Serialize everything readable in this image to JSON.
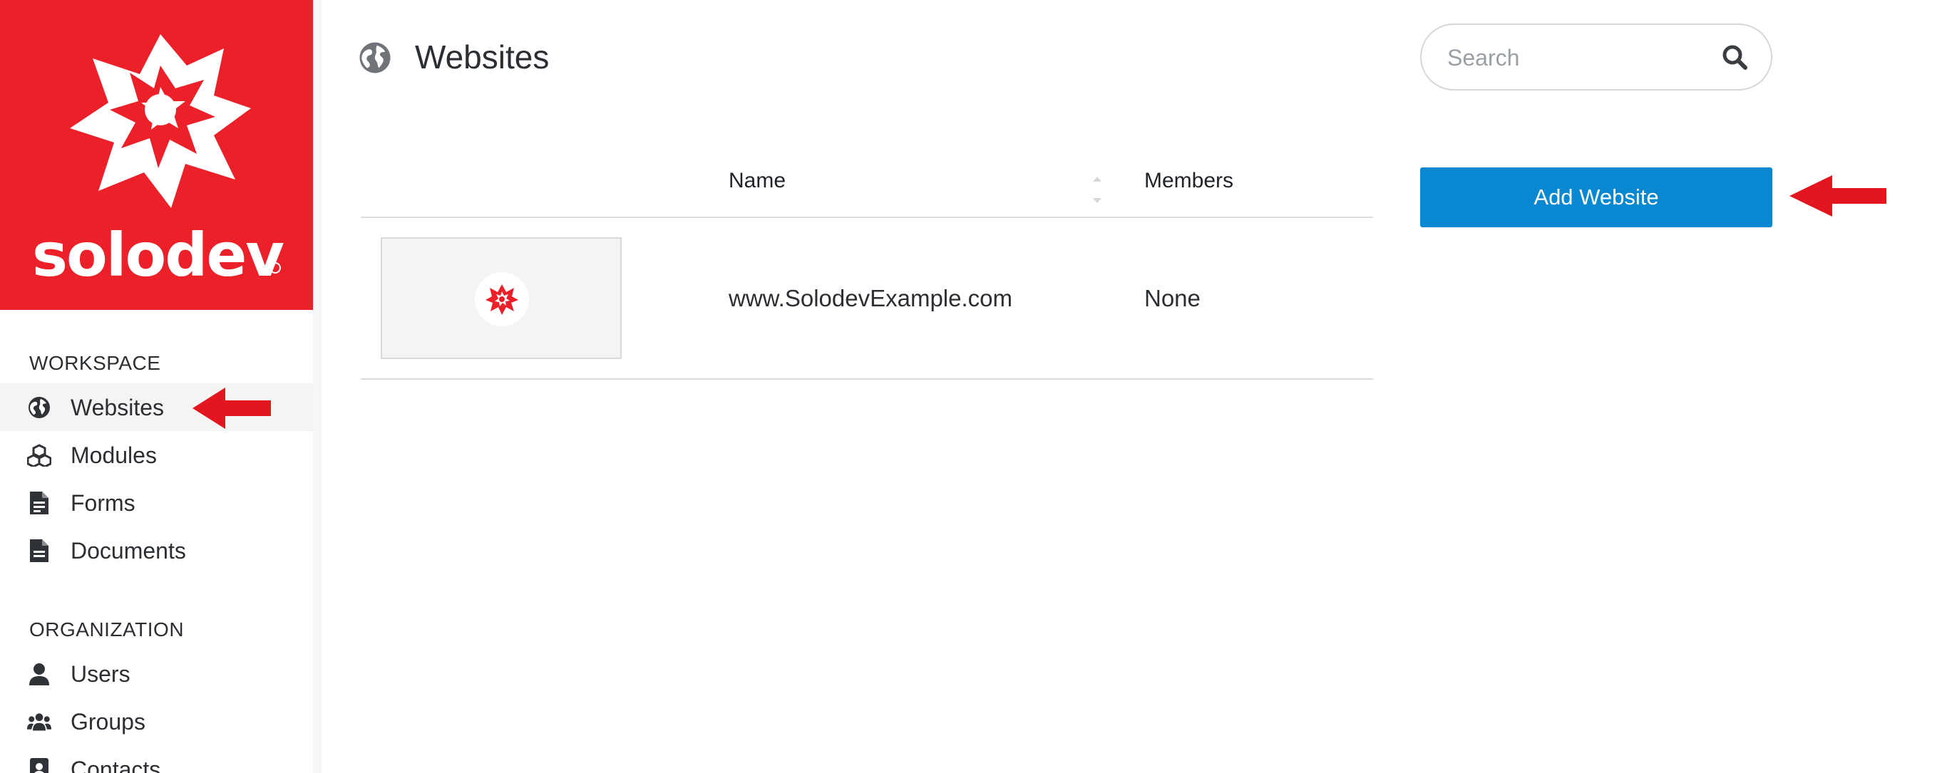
{
  "brand": {
    "name": "solodev",
    "color": "#ec2028"
  },
  "sidebar": {
    "sections": [
      {
        "label": "WORKSPACE",
        "items": [
          {
            "label": "Websites",
            "icon": "globe-icon",
            "active": true
          },
          {
            "label": "Modules",
            "icon": "cubes-icon"
          },
          {
            "label": "Forms",
            "icon": "form-document-icon"
          },
          {
            "label": "Documents",
            "icon": "document-icon"
          }
        ]
      },
      {
        "label": "ORGANIZATION",
        "items": [
          {
            "label": "Users",
            "icon": "user-icon"
          },
          {
            "label": "Groups",
            "icon": "users-group-icon"
          },
          {
            "label": "Contacts",
            "icon": "contact-card-icon"
          }
        ]
      }
    ]
  },
  "header": {
    "title": "Websites",
    "icon": "globe-icon"
  },
  "search": {
    "placeholder": "Search",
    "value": ""
  },
  "actions": {
    "add_label": "Add Website",
    "accent": "#0788d0"
  },
  "table": {
    "columns": [
      "",
      "Name",
      "Members"
    ],
    "rows": [
      {
        "name": "www.SolodevExample.com",
        "members": "None"
      }
    ]
  },
  "annotations": {
    "arrow_color": "#e3151f"
  }
}
